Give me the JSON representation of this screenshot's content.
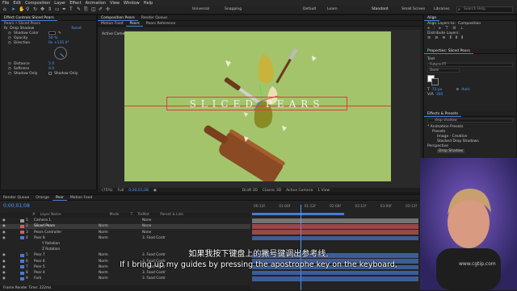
{
  "menu": [
    "File",
    "Edit",
    "Composition",
    "Layer",
    "Effect",
    "Animation",
    "View",
    "Window",
    "Help"
  ],
  "toolbar": {
    "default_label": "Default",
    "learn_label": "Learn",
    "standard_label": "Standard",
    "small_screen_label": "Small Screen",
    "libraries_label": "Libraries",
    "universal_label": "Universal",
    "snapping_label": "Snapping",
    "search_placeholder": "Search Help"
  },
  "effect_controls": {
    "tabs": [
      "Effect Controls Sliced Pears"
    ],
    "layer": "Pears • Sliced Pears",
    "effect": "Drop Shadow",
    "reset": "Reset",
    "props": [
      {
        "name": "Shadow Color",
        "value": ""
      },
      {
        "name": "Opacity",
        "value": "50 %"
      },
      {
        "name": "Direction",
        "value": "0x +135.0°"
      },
      {
        "name": "Distance",
        "value": "5.0"
      },
      {
        "name": "Softness",
        "value": "0.0"
      },
      {
        "name": "Shadow Only",
        "value": "Shadow Only"
      }
    ]
  },
  "viewer": {
    "tabs": [
      "Composition Pears",
      "Render Queue"
    ],
    "sub_tabs": [
      "Motion Food",
      "Pears",
      "Pears Reference"
    ],
    "camera_label": "Active Camera (Default)",
    "comp_title": "SLICED PEARS",
    "bottom": [
      "(75%)",
      "Full",
      "0;00;01;08",
      "Draft 3D",
      "Classic 3D",
      "Active Camera",
      "1 View"
    ]
  },
  "right_panel": {
    "align_title": "Align",
    "align_to": "Align Layers to:",
    "composition": "Composition",
    "distribute": "Distribute Layers:",
    "props_title": "Properties: Sliced Pears",
    "text_label": "Text",
    "font": "Futura PT",
    "style": "Demi",
    "size": "72 px",
    "tracking": "Auto",
    "leading": "100",
    "effects_title": "Effects & Presets",
    "search": "drop shadow",
    "tree": [
      "* Animation Presets",
      "Presets",
      "Image - Creative",
      "Stacked Drop Shadows",
      "Perspective",
      "Drop Shadow"
    ]
  },
  "timeline": {
    "tabs": [
      "Render Queue",
      "Orange",
      "Pear",
      "Motion Food"
    ],
    "time": "0;00;01;08",
    "headers": [
      "#",
      "Layer Name",
      "Mode",
      "T",
      "TrkMat",
      "Parent & Link"
    ],
    "layers": [
      {
        "num": "1",
        "name": "Camera 1",
        "mode": "",
        "parent": "None",
        "color": "#9c9c9c"
      },
      {
        "num": "2",
        "name": "Sliced Pears",
        "mode": "Norm",
        "parent": "None",
        "color": "#d45d5d"
      },
      {
        "num": "3",
        "name": "Pears Controller",
        "mode": "Norm",
        "parent": "None",
        "color": "#d45d5d"
      },
      {
        "num": "4",
        "name": "Pear 8",
        "mode": "Norm",
        "parent": "3. Food Contr",
        "color": "#4a7bd4"
      },
      {
        "num": "",
        "name": "Y Rotation",
        "mode": "",
        "parent": "",
        "color": ""
      },
      {
        "num": "",
        "name": "Z Rotation",
        "mode": "",
        "parent": "",
        "color": ""
      },
      {
        "num": "5",
        "name": "Pear 7",
        "mode": "Norm",
        "parent": "3. Food Contr",
        "color": "#4a7bd4"
      },
      {
        "num": "6",
        "name": "Pear 6",
        "mode": "Norm",
        "parent": "3. Food Contr",
        "color": "#4a7bd4"
      },
      {
        "num": "7",
        "name": "Pear 5",
        "mode": "Norm",
        "parent": "3. Food Contr",
        "color": "#4a7bd4"
      },
      {
        "num": "8",
        "name": "Pear 4",
        "mode": "Norm",
        "parent": "3. Food Contr",
        "color": "#4a7bd4"
      },
      {
        "num": "9",
        "name": "Fork",
        "mode": "Norm",
        "parent": "3. Food Contr",
        "color": "#4a7bd4"
      }
    ],
    "render_time": "Frame Render Time: 222ms",
    "ruler": [
      "00:12f",
      "01:00f",
      "01:12f",
      "02:00f",
      "02:12f",
      "03:00f",
      "03:12f"
    ]
  },
  "subtitles": {
    "cn": "如果我按下键盘上的撇号键调出参考线,",
    "en": "If I bring up my guides by pressing the apostrophe key on the keyboard,"
  },
  "watermark": "www.cgtip.com"
}
